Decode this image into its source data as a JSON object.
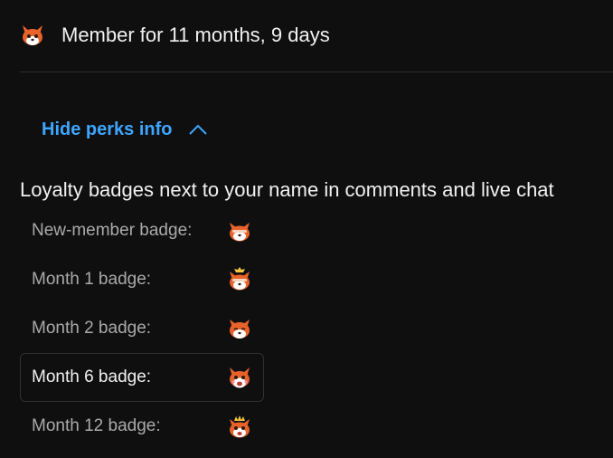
{
  "membership": {
    "avatar_icon": "fox-avatar-icon",
    "text": "Member for 11 months, 9 days"
  },
  "perks_toggle": {
    "label": "Hide perks info",
    "icon": "chevron-up-icon"
  },
  "perks": {
    "heading": "Loyalty badges next to your name in comments and live chat",
    "badges": [
      {
        "label": "New-member badge:",
        "icon": "fox-badge-new-icon",
        "selected": false
      },
      {
        "label": "Month 1 badge:",
        "icon": "fox-badge-month1-icon",
        "selected": false
      },
      {
        "label": "Month 2 badge:",
        "icon": "fox-badge-month2-icon",
        "selected": false
      },
      {
        "label": "Month 6 badge:",
        "icon": "fox-badge-month6-icon",
        "selected": true
      },
      {
        "label": "Month 12 badge:",
        "icon": "fox-badge-month12-icon",
        "selected": false
      }
    ]
  },
  "colors": {
    "background": "#0f0f0f",
    "accent_link": "#3ea6ff",
    "text_primary": "#f1f1f1",
    "text_secondary": "#aaaaaa",
    "fox_orange": "#e8622b"
  }
}
